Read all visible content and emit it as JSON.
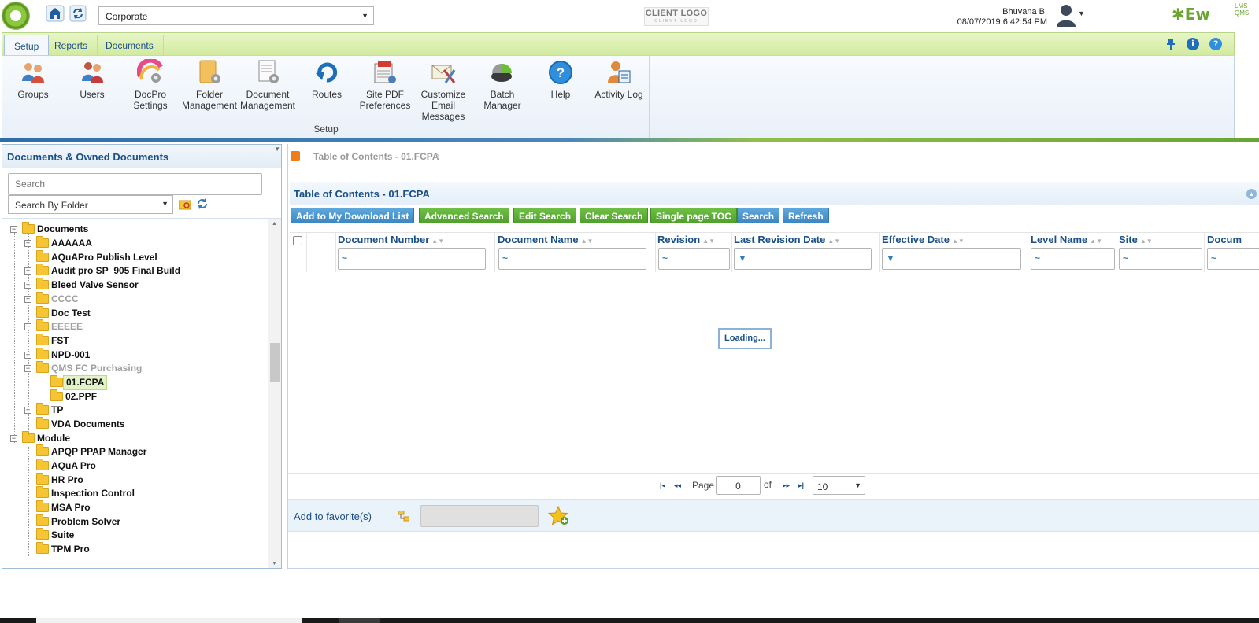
{
  "topbar": {
    "site": "Corporate",
    "client_logo": "CLIENT LOGO",
    "client_logo_sub": "CLIENT LOGO",
    "user_name": "Bhuvana B",
    "datetime": "08/07/2019 6:42:54 PM",
    "brand": "Ew",
    "brand_suffix_top": "LMS",
    "brand_suffix_bottom": "QMS"
  },
  "ribbon": {
    "tabs": [
      "Setup",
      "Reports",
      "Documents"
    ],
    "active_tab": "Setup",
    "group_label": "Setup",
    "buttons": [
      {
        "line1": "Groups",
        "line2": "",
        "line3": "",
        "icon": "groups-icon"
      },
      {
        "line1": "Users",
        "line2": "",
        "line3": "",
        "icon": "users-icon"
      },
      {
        "line1": "DocPro",
        "line2": "Settings",
        "line3": "",
        "icon": "docpro-settings-icon"
      },
      {
        "line1": "Folder",
        "line2": "Management",
        "line3": "",
        "icon": "folder-management-icon"
      },
      {
        "line1": "Document",
        "line2": "Management",
        "line3": "",
        "icon": "document-management-icon"
      },
      {
        "line1": "Routes",
        "line2": "",
        "line3": "",
        "icon": "routes-icon"
      },
      {
        "line1": "Site PDF",
        "line2": "Preferences",
        "line3": "",
        "icon": "site-pdf-icon"
      },
      {
        "line1": "Customize",
        "line2": "Email",
        "line3": "Messages",
        "icon": "email-icon"
      },
      {
        "line1": "Batch",
        "line2": "Manager",
        "line3": "",
        "icon": "batch-manager-icon"
      },
      {
        "line1": "Help",
        "line2": "",
        "line3": "",
        "icon": "help-icon"
      },
      {
        "line1": "Activity Log",
        "line2": "",
        "line3": "",
        "icon": "activity-log-icon"
      }
    ]
  },
  "left_panel": {
    "title": "Documents & Owned Documents",
    "search_placeholder": "Search",
    "search_by": "Search By Folder",
    "tree": {
      "documents_root": "Documents",
      "module_root": "Module",
      "documents": [
        "AAAAAA",
        "AQuAPro Publish Level",
        "Audit pro SP_905 Final Build",
        "Bleed Valve Sensor",
        "CCCC",
        "Doc Test",
        "EEEEE",
        "FST",
        "NPD-001",
        "QMS FC Purchasing",
        "TP",
        "VDA Documents"
      ],
      "qms_children": [
        "01.FCPA",
        "02.PPF"
      ],
      "modules": [
        "APQP PPAP Manager",
        "AQuA Pro",
        "HR Pro",
        "Inspection Control",
        "MSA Pro",
        "Problem Solver",
        "Suite",
        "TPM Pro"
      ]
    }
  },
  "main": {
    "breadcrumb": "Table of Contents - 01.FCPA",
    "header": "Table of Contents - 01.FCPA",
    "toolbar": [
      "Add to My Download List",
      "Advanced Search",
      "Edit Search",
      "Clear Search",
      "Single page TOC",
      "Search",
      "Refresh"
    ],
    "columns": [
      "Document Number",
      "Document Name",
      "Revision",
      "Last Revision Date",
      "Effective Date",
      "Level Name",
      "Site",
      "Docum"
    ],
    "filter_tilde": "~",
    "loading": "Loading...",
    "pager": {
      "page_label": "Page",
      "page_value": "0",
      "of_label": "of",
      "page_size": "10"
    },
    "favorites_label": "Add to favorite(s)"
  }
}
